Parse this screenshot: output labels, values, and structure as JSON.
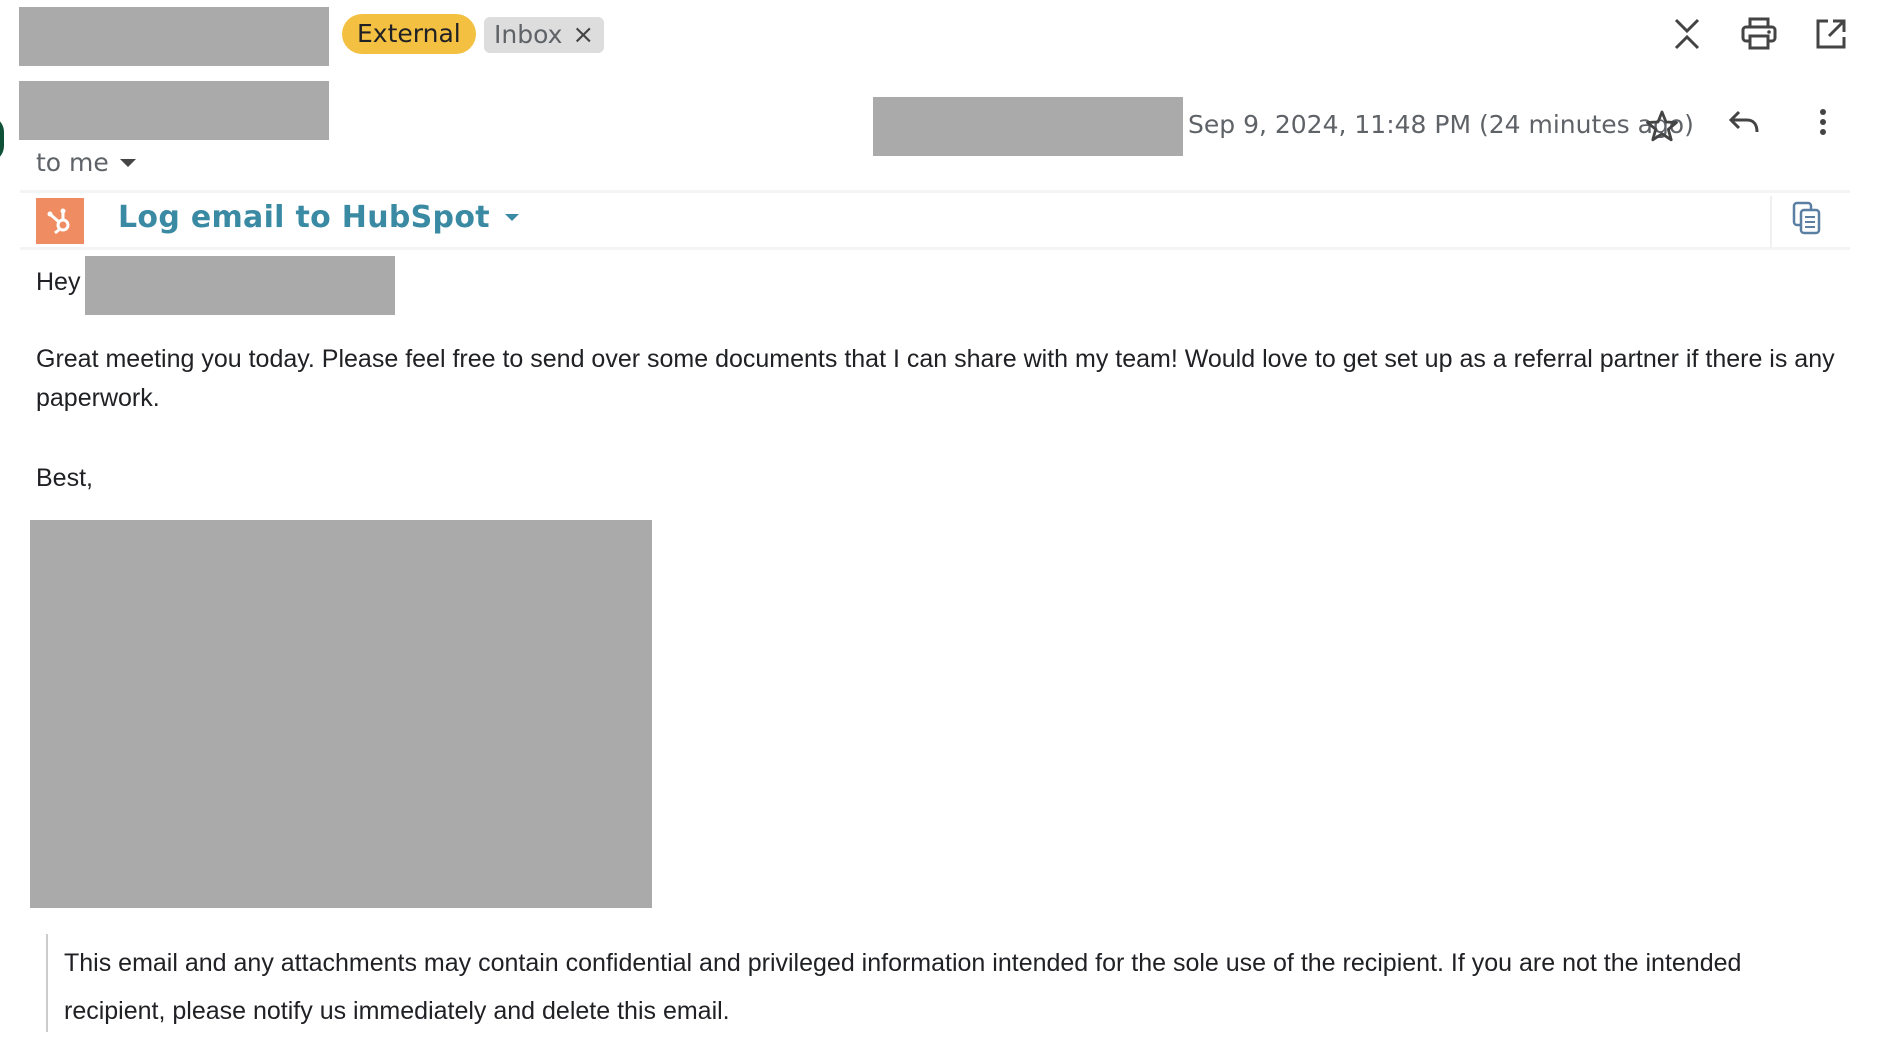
{
  "labels": {
    "external": "External",
    "inbox": "Inbox",
    "inbox_remove": "×"
  },
  "header": {
    "timestamp": "Sep 9, 2024, 11:48 PM (24 minutes ago)",
    "recipient": "to me"
  },
  "toolbar_icons": [
    "collapse-all-icon",
    "print-icon",
    "open-in-new-window-icon"
  ],
  "message_actions": [
    "star-icon",
    "reply-icon",
    "more-options-icon"
  ],
  "hubspot": {
    "link_text": "Log email to HubSpot",
    "brand_color": "#f08c61",
    "link_color": "#3b8aa4"
  },
  "message": {
    "greeting": "Hey",
    "paragraph": "Great meeting you today. Please feel free to send over some documents that I can share with my team! Would love to get set up as a referral partner if there is any paperwork.",
    "signoff": "Best,",
    "disclaimer": "This email and any attachments may contain confidential and privileged information intended for the sole use of the recipient. If you are not the intended recipient, please notify us immediately and delete this email."
  },
  "colors": {
    "external_label": "#f4c042",
    "inbox_label": "#dddddd",
    "redaction": "#aaaaaa"
  }
}
